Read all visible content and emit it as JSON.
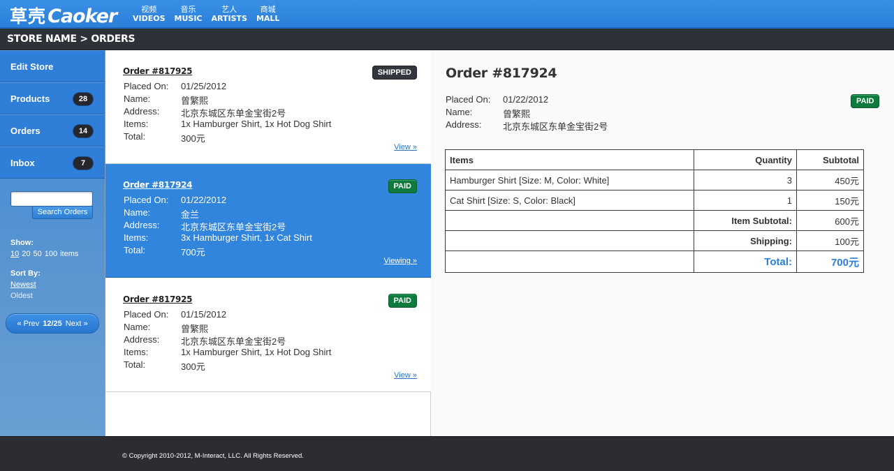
{
  "brand": {
    "logo_cn": "草壳",
    "logo_en": "Caoker"
  },
  "nav": [
    {
      "zh": "视频",
      "en": "VIDEOS"
    },
    {
      "zh": "音乐",
      "en": "MUSIC"
    },
    {
      "zh": "艺人",
      "en": "ARTISTS"
    },
    {
      "zh": "商城",
      "en": "MALL"
    }
  ],
  "breadcrumb": "STORE NAME > ORDERS",
  "sidebar": {
    "items": [
      {
        "label": "Edit Store",
        "count": ""
      },
      {
        "label": "Products",
        "count": "28"
      },
      {
        "label": "Orders",
        "count": "14"
      },
      {
        "label": "Inbox",
        "count": "7"
      }
    ],
    "search_value": "",
    "search_button": "Search Orders",
    "show_label": "Show:",
    "show_options": [
      "10",
      "20",
      "50",
      "100"
    ],
    "show_suffix": "items",
    "sort_label": "Sort By:",
    "sort_newest": "Newest",
    "sort_oldest": "Oldest",
    "pager": {
      "prev": "« Prev",
      "page": "12/25",
      "next": "Next »"
    }
  },
  "labels": {
    "placed_on": "Placed On:",
    "name": "Name:",
    "address": "Address:",
    "items": "Items:",
    "total": "Total:"
  },
  "orders": [
    {
      "title": "Order #817925",
      "status": "SHIPPED",
      "placed_on": "01/25/2012",
      "name": "曾繁熙",
      "address": "北京东城区东单金宝街2号",
      "items": "1x Hamburger Shirt, 1x Hot Dog Shirt",
      "total": "300元",
      "link": "View »"
    },
    {
      "title": "Order #817924",
      "status": "PAID",
      "placed_on": "01/22/2012",
      "name": "金兰",
      "address": "北京东城区东单金宝街2号",
      "items": "3x Hamburger Shirt, 1x Cat Shirt",
      "total": "700元",
      "link": "Viewing »"
    },
    {
      "title": "Order #817925",
      "status": "PAID",
      "placed_on": "01/15/2012",
      "name": "曾繁熙",
      "address": "北京东城区东单金宝街2号",
      "items": "1x Hamburger Shirt, 1x Hot Dog Shirt",
      "total": "300元",
      "link": "View »"
    }
  ],
  "detail": {
    "title": "Order #817924",
    "status": "PAID",
    "placed_on": "01/22/2012",
    "name": "曾繁熙",
    "address": "北京东城区东单金宝街2号",
    "table": {
      "headers": [
        "Items",
        "Quantity",
        "Subtotal"
      ],
      "rows": [
        {
          "item": "Hamburger Shirt [Size: M, Color: White]",
          "qty": "3",
          "subtotal": "450元"
        },
        {
          "item": "Cat Shirt [Size: S, Color: Black]",
          "qty": "1",
          "subtotal": "150元"
        }
      ],
      "item_subtotal_label": "Item Subtotal:",
      "item_subtotal": "600元",
      "shipping_label": "Shipping:",
      "shipping": "100元",
      "total_label": "Total:",
      "total": "700元"
    }
  },
  "footer": {
    "copyright": "© Copyright 2010-2012, M-Interact, LLC. All Rights Reserved."
  },
  "colors": {
    "accent": "#2f7fd9",
    "paid": "#0f7a3d",
    "shipped": "#33363d",
    "dark": "#2b2d33"
  }
}
